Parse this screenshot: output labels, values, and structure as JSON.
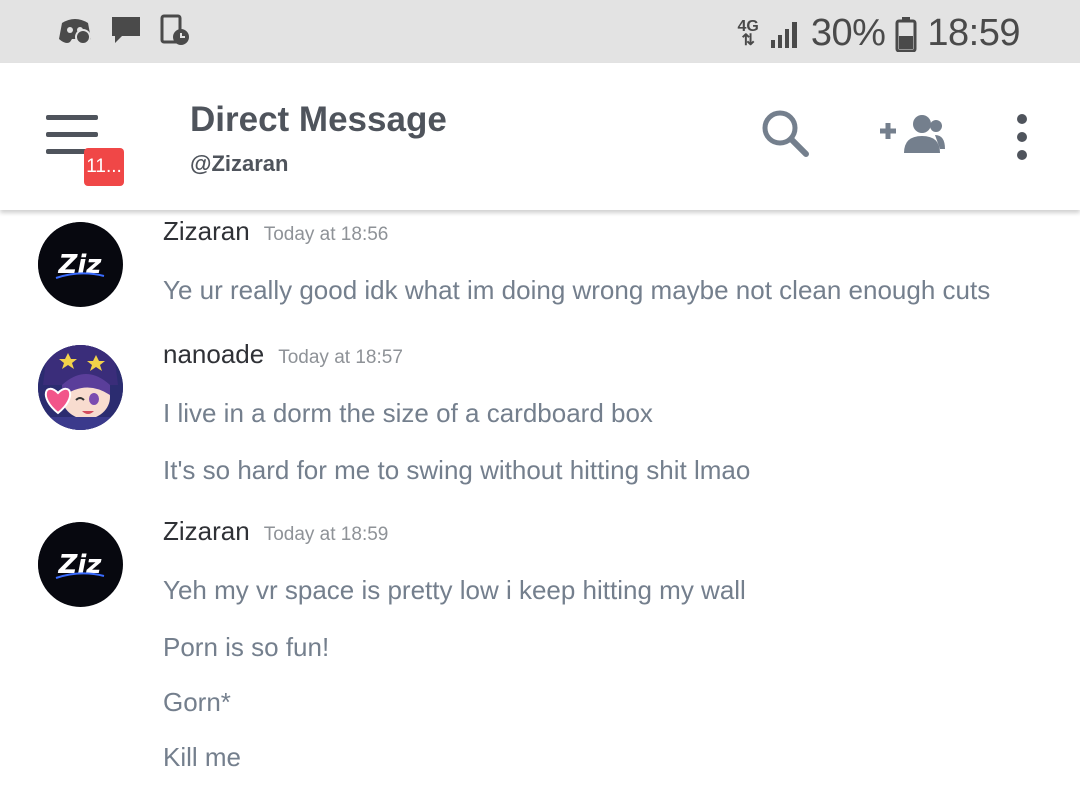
{
  "status": {
    "network": "4G",
    "battery_percent": "30%",
    "time": "18:59"
  },
  "header": {
    "title": "Direct Message",
    "subtitle": "@Zizaran",
    "badge_count": "11..."
  },
  "messages": [
    {
      "author": "Zizaran",
      "avatar_text": "Ziz",
      "timestamp": "Today at 18:56",
      "lines": [
        "Ye ur really good idk what im doing wrong maybe not clean enough cuts"
      ]
    },
    {
      "author": "nanoade",
      "timestamp": "Today at 18:57",
      "lines": [
        "I live in a dorm the size of a cardboard box",
        "It's so hard for me to swing without hitting shit lmao"
      ]
    },
    {
      "author": "Zizaran",
      "avatar_text": "Ziz",
      "timestamp": "Today at 18:59",
      "lines": [
        "Yeh my vr space is pretty low i keep hitting my wall",
        "Porn is so fun!",
        "Gorn*",
        "Kill me"
      ]
    }
  ],
  "colors": {
    "badge": "#f04747",
    "icon": "#4f545c",
    "accent_icon": "#747f8d",
    "message_text": "#747f8d"
  }
}
